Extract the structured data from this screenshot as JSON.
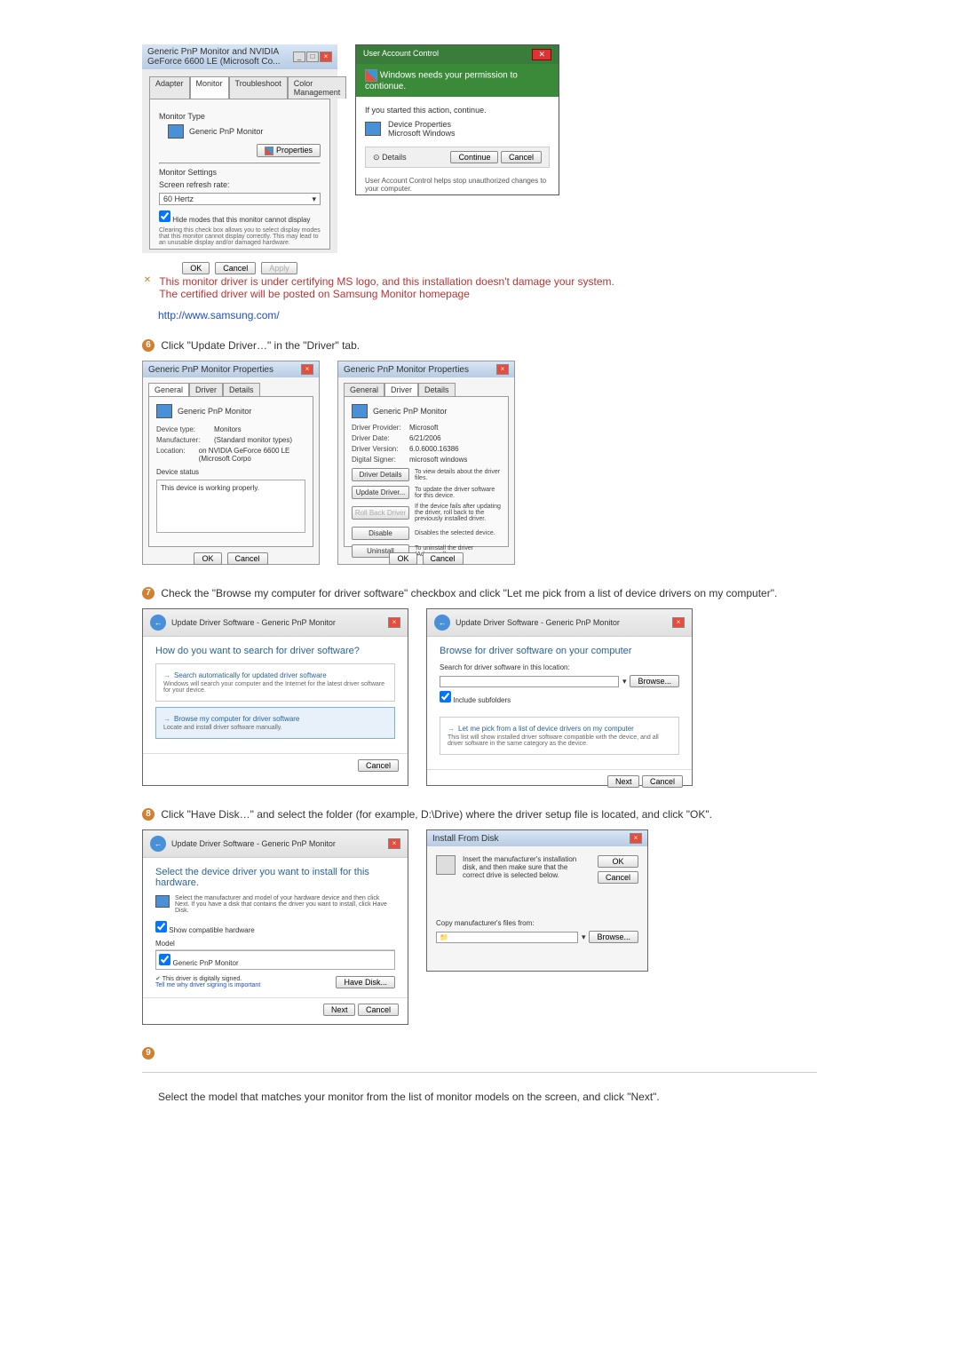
{
  "dlg1": {
    "title": "Generic PnP Monitor and NVIDIA GeForce 6600 LE (Microsoft Co...",
    "tabs": [
      "Adapter",
      "Monitor",
      "Troubleshoot",
      "Color Management"
    ],
    "monitor_type_label": "Monitor Type",
    "monitor_name": "Generic PnP Monitor",
    "properties_btn": "Properties",
    "monitor_settings_label": "Monitor Settings",
    "refresh_label": "Screen refresh rate:",
    "refresh_value": "60 Hertz",
    "hide_modes_label": "Hide modes that this monitor cannot display",
    "hide_modes_desc": "Clearing this check box allows you to select display modes that this monitor cannot display correctly. This may lead to an unusable display and/or damaged hardware.",
    "ok": "OK",
    "cancel": "Cancel",
    "apply": "Apply"
  },
  "uac": {
    "title": "User Account Control",
    "banner": "Windows needs your permission to contionue.",
    "started": "If you started this action, continue.",
    "device_props": "Device Properties",
    "ms_windows": "Microsoft Windows",
    "details": "Details",
    "continue": "Continue",
    "cancel": "Cancel",
    "footer": "User Account Control helps stop unauthorized changes to your computer."
  },
  "note": {
    "line1": "This monitor driver is under certifying MS logo, and this installation doesn't damage your system.",
    "line2": "The certified driver will be posted on Samsung Monitor homepage",
    "link": "http://www.samsung.com/"
  },
  "step6": {
    "num": "6",
    "text": "Click \"Update Driver…\" in the \"Driver\" tab."
  },
  "gen_props": {
    "title": "Generic PnP Monitor Properties",
    "tabs": [
      "General",
      "Driver",
      "Details"
    ],
    "device_name": "Generic PnP Monitor",
    "device_type_lbl": "Device type:",
    "device_type": "Monitors",
    "manufacturer_lbl": "Manufacturer:",
    "manufacturer": "(Standard monitor types)",
    "location_lbl": "Location:",
    "location": "on NVIDIA GeForce 6600 LE (Microsoft Corpo",
    "status_lbl": "Device status",
    "status": "This device is working properly.",
    "ok": "OK",
    "cancel": "Cancel"
  },
  "driver_props": {
    "title": "Generic PnP Monitor Properties",
    "tabs": [
      "General",
      "Driver",
      "Details"
    ],
    "device_name": "Generic PnP Monitor",
    "provider_lbl": "Driver Provider:",
    "provider": "Microsoft",
    "date_lbl": "Driver Date:",
    "date": "6/21/2006",
    "version_lbl": "Driver Version:",
    "version": "6.0.6000.16386",
    "signer_lbl": "Digital Signer:",
    "signer": "microsoft windows",
    "details_btn": "Driver Details",
    "details_desc": "To view details about the driver files.",
    "update_btn": "Update Driver...",
    "update_desc": "To update the driver software for this device.",
    "rollback_btn": "Roll Back Driver",
    "rollback_desc": "If the device fails after updating the driver, roll back to the previously installed driver.",
    "disable_btn": "Disable",
    "disable_desc": "Disables the selected device.",
    "uninstall_btn": "Uninstall",
    "uninstall_desc": "To uninstall the driver (Advanced).",
    "ok": "OK",
    "cancel": "Cancel"
  },
  "step7": {
    "num": "7",
    "text": "Check the \"Browse my computer for driver software\" checkbox and click \"Let me pick from a list of device drivers on my computer\"."
  },
  "wiz1": {
    "header": "Update Driver Software - Generic PnP Monitor",
    "title": "How do you want to search for driver software?",
    "opt1_title": "Search automatically for updated driver software",
    "opt1_desc": "Windows will search your computer and the Internet for the latest driver software for your device.",
    "opt2_title": "Browse my computer for driver software",
    "opt2_desc": "Locate and install driver software manually.",
    "cancel": "Cancel"
  },
  "wiz2": {
    "header": "Update Driver Software - Generic PnP Monitor",
    "title": "Browse for driver software on your computer",
    "search_lbl": "Search for driver software in this location:",
    "browse": "Browse...",
    "include": "Include subfolders",
    "pick_title": "Let me pick from a list of device drivers on my computer",
    "pick_desc": "This list will show installed driver software compatible with the device, and all driver software in the same category as the device.",
    "next": "Next",
    "cancel": "Cancel"
  },
  "step8": {
    "num": "8",
    "text": "Click \"Have Disk…\" and select the folder (for example, D:\\Drive) where the driver setup file is located, and click \"OK\"."
  },
  "wiz3": {
    "header": "Update Driver Software - Generic PnP Monitor",
    "title": "Select the device driver you want to install for this hardware.",
    "desc": "Select the manufacturer and model of your hardware device and then click Next. If you have a disk that contains the driver you want to install, click Have Disk.",
    "compat": "Show compatible hardware",
    "model_lbl": "Model",
    "model": "Generic PnP Monitor",
    "signed": "This driver is digitally signed.",
    "tell_why": "Tell me why driver signing is important",
    "have_disk": "Have Disk...",
    "next": "Next",
    "cancel": "Cancel"
  },
  "install_disk": {
    "title": "Install From Disk",
    "text": "Insert the manufacturer's installation disk, and then make sure that the correct drive is selected below.",
    "ok": "OK",
    "cancel": "Cancel",
    "copy_lbl": "Copy manufacturer's files from:",
    "browse": "Browse..."
  },
  "step9": {
    "num": "9",
    "text": "Select the model that matches your monitor from the list of monitor models on the screen, and click \"Next\"."
  }
}
